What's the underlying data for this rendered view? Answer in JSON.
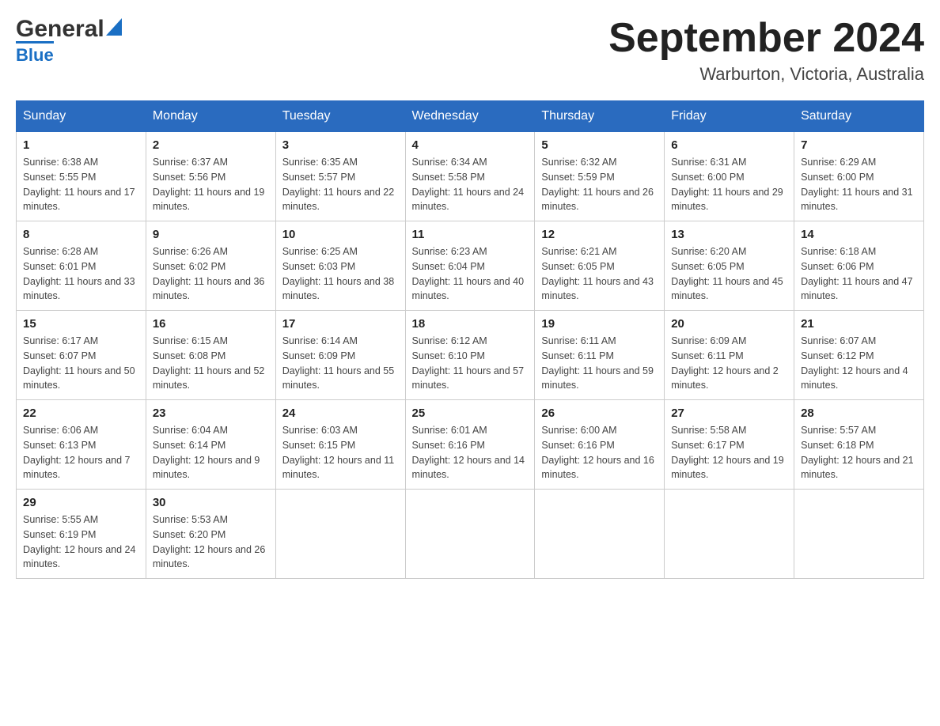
{
  "logo": {
    "general": "General",
    "blue": "Blue",
    "tagline": "Blue"
  },
  "header": {
    "month_year": "September 2024",
    "location": "Warburton, Victoria, Australia"
  },
  "weekdays": [
    "Sunday",
    "Monday",
    "Tuesday",
    "Wednesday",
    "Thursday",
    "Friday",
    "Saturday"
  ],
  "weeks": [
    [
      {
        "day": "1",
        "sunrise": "6:38 AM",
        "sunset": "5:55 PM",
        "daylight": "11 hours and 17 minutes."
      },
      {
        "day": "2",
        "sunrise": "6:37 AM",
        "sunset": "5:56 PM",
        "daylight": "11 hours and 19 minutes."
      },
      {
        "day": "3",
        "sunrise": "6:35 AM",
        "sunset": "5:57 PM",
        "daylight": "11 hours and 22 minutes."
      },
      {
        "day": "4",
        "sunrise": "6:34 AM",
        "sunset": "5:58 PM",
        "daylight": "11 hours and 24 minutes."
      },
      {
        "day": "5",
        "sunrise": "6:32 AM",
        "sunset": "5:59 PM",
        "daylight": "11 hours and 26 minutes."
      },
      {
        "day": "6",
        "sunrise": "6:31 AM",
        "sunset": "6:00 PM",
        "daylight": "11 hours and 29 minutes."
      },
      {
        "day": "7",
        "sunrise": "6:29 AM",
        "sunset": "6:00 PM",
        "daylight": "11 hours and 31 minutes."
      }
    ],
    [
      {
        "day": "8",
        "sunrise": "6:28 AM",
        "sunset": "6:01 PM",
        "daylight": "11 hours and 33 minutes."
      },
      {
        "day": "9",
        "sunrise": "6:26 AM",
        "sunset": "6:02 PM",
        "daylight": "11 hours and 36 minutes."
      },
      {
        "day": "10",
        "sunrise": "6:25 AM",
        "sunset": "6:03 PM",
        "daylight": "11 hours and 38 minutes."
      },
      {
        "day": "11",
        "sunrise": "6:23 AM",
        "sunset": "6:04 PM",
        "daylight": "11 hours and 40 minutes."
      },
      {
        "day": "12",
        "sunrise": "6:21 AM",
        "sunset": "6:05 PM",
        "daylight": "11 hours and 43 minutes."
      },
      {
        "day": "13",
        "sunrise": "6:20 AM",
        "sunset": "6:05 PM",
        "daylight": "11 hours and 45 minutes."
      },
      {
        "day": "14",
        "sunrise": "6:18 AM",
        "sunset": "6:06 PM",
        "daylight": "11 hours and 47 minutes."
      }
    ],
    [
      {
        "day": "15",
        "sunrise": "6:17 AM",
        "sunset": "6:07 PM",
        "daylight": "11 hours and 50 minutes."
      },
      {
        "day": "16",
        "sunrise": "6:15 AM",
        "sunset": "6:08 PM",
        "daylight": "11 hours and 52 minutes."
      },
      {
        "day": "17",
        "sunrise": "6:14 AM",
        "sunset": "6:09 PM",
        "daylight": "11 hours and 55 minutes."
      },
      {
        "day": "18",
        "sunrise": "6:12 AM",
        "sunset": "6:10 PM",
        "daylight": "11 hours and 57 minutes."
      },
      {
        "day": "19",
        "sunrise": "6:11 AM",
        "sunset": "6:11 PM",
        "daylight": "11 hours and 59 minutes."
      },
      {
        "day": "20",
        "sunrise": "6:09 AM",
        "sunset": "6:11 PM",
        "daylight": "12 hours and 2 minutes."
      },
      {
        "day": "21",
        "sunrise": "6:07 AM",
        "sunset": "6:12 PM",
        "daylight": "12 hours and 4 minutes."
      }
    ],
    [
      {
        "day": "22",
        "sunrise": "6:06 AM",
        "sunset": "6:13 PM",
        "daylight": "12 hours and 7 minutes."
      },
      {
        "day": "23",
        "sunrise": "6:04 AM",
        "sunset": "6:14 PM",
        "daylight": "12 hours and 9 minutes."
      },
      {
        "day": "24",
        "sunrise": "6:03 AM",
        "sunset": "6:15 PM",
        "daylight": "12 hours and 11 minutes."
      },
      {
        "day": "25",
        "sunrise": "6:01 AM",
        "sunset": "6:16 PM",
        "daylight": "12 hours and 14 minutes."
      },
      {
        "day": "26",
        "sunrise": "6:00 AM",
        "sunset": "6:16 PM",
        "daylight": "12 hours and 16 minutes."
      },
      {
        "day": "27",
        "sunrise": "5:58 AM",
        "sunset": "6:17 PM",
        "daylight": "12 hours and 19 minutes."
      },
      {
        "day": "28",
        "sunrise": "5:57 AM",
        "sunset": "6:18 PM",
        "daylight": "12 hours and 21 minutes."
      }
    ],
    [
      {
        "day": "29",
        "sunrise": "5:55 AM",
        "sunset": "6:19 PM",
        "daylight": "12 hours and 24 minutes."
      },
      {
        "day": "30",
        "sunrise": "5:53 AM",
        "sunset": "6:20 PM",
        "daylight": "12 hours and 26 minutes."
      },
      null,
      null,
      null,
      null,
      null
    ]
  ]
}
